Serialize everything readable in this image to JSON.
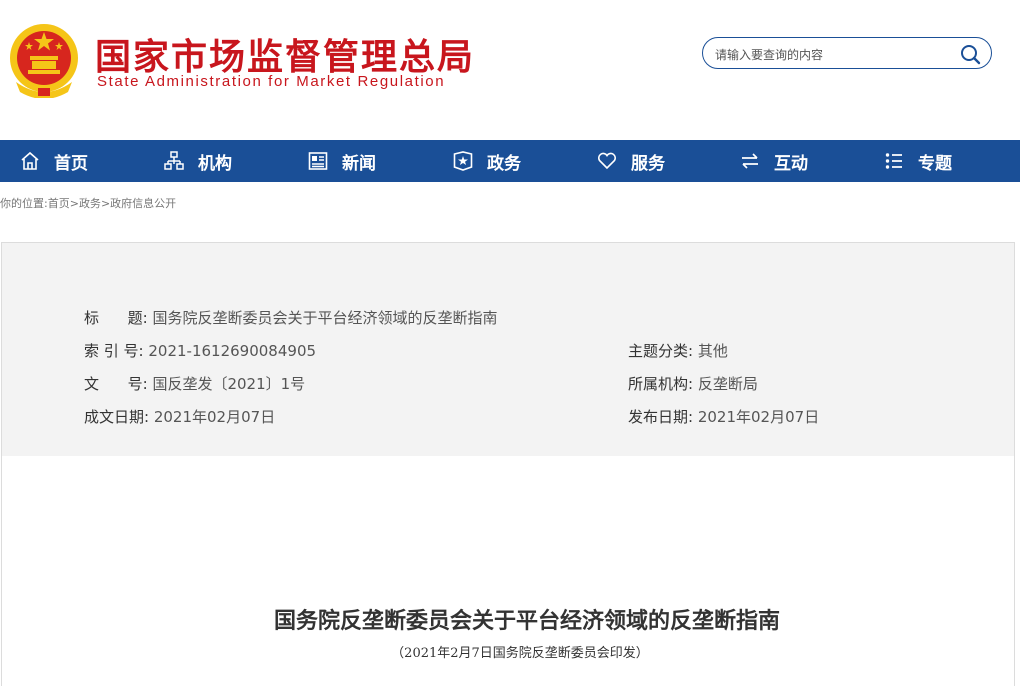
{
  "header": {
    "title_cn": "国家市场监督管理总局",
    "title_en": "State Administration for Market Regulation",
    "search_placeholder": "请输入要查询的内容"
  },
  "colors": {
    "brand_red": "#c8161d",
    "nav_blue": "#1a4f97",
    "emblem_gold": "#f5c518"
  },
  "nav": [
    {
      "label": "首页",
      "icon": "home-icon"
    },
    {
      "label": "机构",
      "icon": "org-chart-icon"
    },
    {
      "label": "新闻",
      "icon": "news-icon"
    },
    {
      "label": "政务",
      "icon": "government-icon"
    },
    {
      "label": "服务",
      "icon": "heart-icon"
    },
    {
      "label": "互动",
      "icon": "exchange-arrows-icon"
    },
    {
      "label": "专题",
      "icon": "topics-list-icon"
    }
  ],
  "breadcrumb": {
    "prefix": "你的位置:",
    "items": [
      "首页",
      "政务",
      "政府信息公开"
    ],
    "separator": ">"
  },
  "info": {
    "title_label": "标      题:",
    "title_value": "国务院反垄断委员会关于平台经济领域的反垄断指南",
    "index_label": "索 引 号:",
    "index_value": "2021-1612690084905",
    "doc_no_label": "文      号:",
    "doc_no_value": "国反垄发〔2021〕1号",
    "created_label": "成文日期:",
    "created_value": "2021年02月07日",
    "category_label": "主题分类:",
    "category_value": "其他",
    "agency_label": "所属机构:",
    "agency_value": "反垄断局",
    "published_label": "发布日期:",
    "published_value": "2021年02月07日"
  },
  "document": {
    "title": "国务院反垄断委员会关于平台经济领域的反垄断指南",
    "subtitle": "（2021年2月7日国务院反垄断委员会印发）"
  }
}
